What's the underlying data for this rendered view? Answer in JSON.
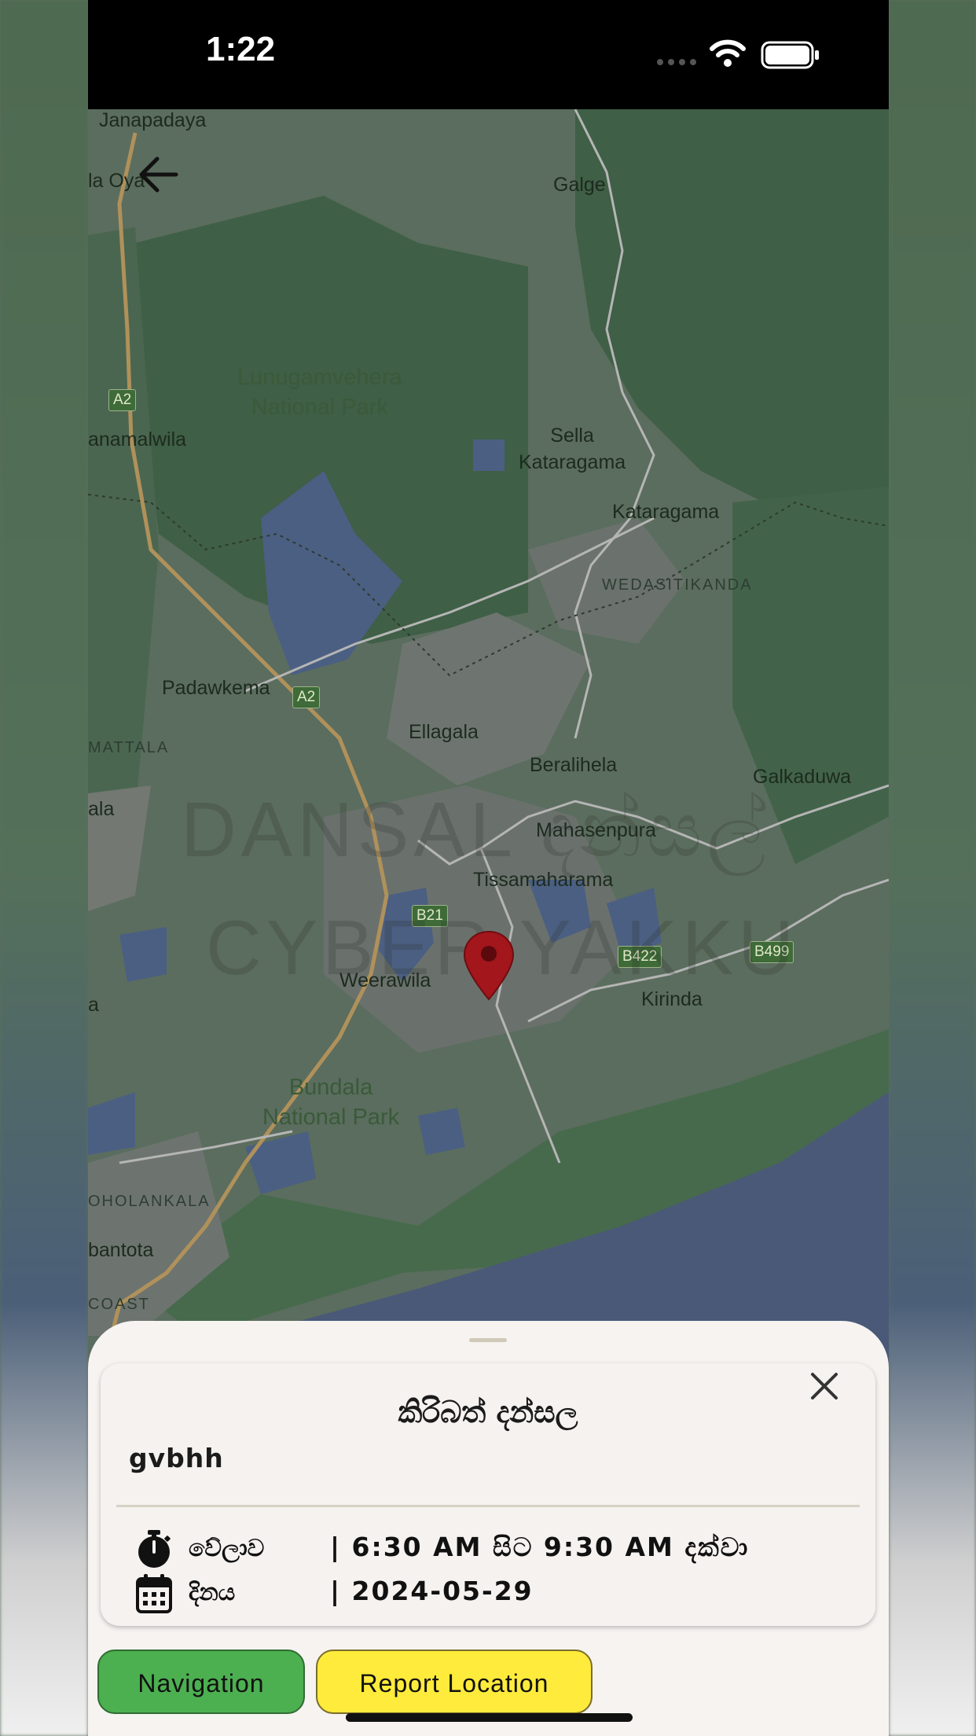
{
  "status_bar": {
    "time": "1:22"
  },
  "map": {
    "labels": {
      "janapadaya": "Janapadaya",
      "la_oya": "la Oya",
      "galge": "Galge",
      "lunugamvehera": "Lunugamvehera\nNational Park",
      "anamalwila": "anamalwila",
      "sella_kataragama": "Sella\nKataragama",
      "kataragama": "Kataragama",
      "wedasitikanda": "WEDASITIKANDA",
      "padawkema": "Padawkema",
      "mattala": "MATTALA",
      "ellagala": "Ellagala",
      "beralihela": "Beralihela",
      "galkaduwa": "Galkaduwa",
      "ala": "ala",
      "mahasenpura": "Mahasenpura",
      "tissamaharama": "Tissamaharama",
      "weerawila": "Weerawila",
      "kirinda": "Kirinda",
      "a": "a",
      "bundala": "Bundala\nNational Park",
      "hholankala": "OHOLANKALA",
      "bantota": "bantota",
      "coast": "COAST"
    },
    "shields": {
      "a2_top": "A2",
      "a2_mid": "A2",
      "b21": "B21",
      "b422": "B422",
      "b499": "B499"
    },
    "watermark_line1": "DANSAL දන්සල්",
    "watermark_line2": "CYBER YAKKU"
  },
  "sheet": {
    "title": "කිරිබත් දන්සල",
    "subtitle": "gvbhh",
    "time_label": "වේලාව",
    "time_value": "| 6:30 AM සිට 9:30 AM දක්වා",
    "date_label": "දිනය",
    "date_value": "| 2024-05-29",
    "navigation_label": "Navigation",
    "report_label": "Report Location"
  },
  "colors": {
    "navigation_button": "#4caf50",
    "report_button": "#ffeb3b",
    "pin": "#a3161c"
  }
}
